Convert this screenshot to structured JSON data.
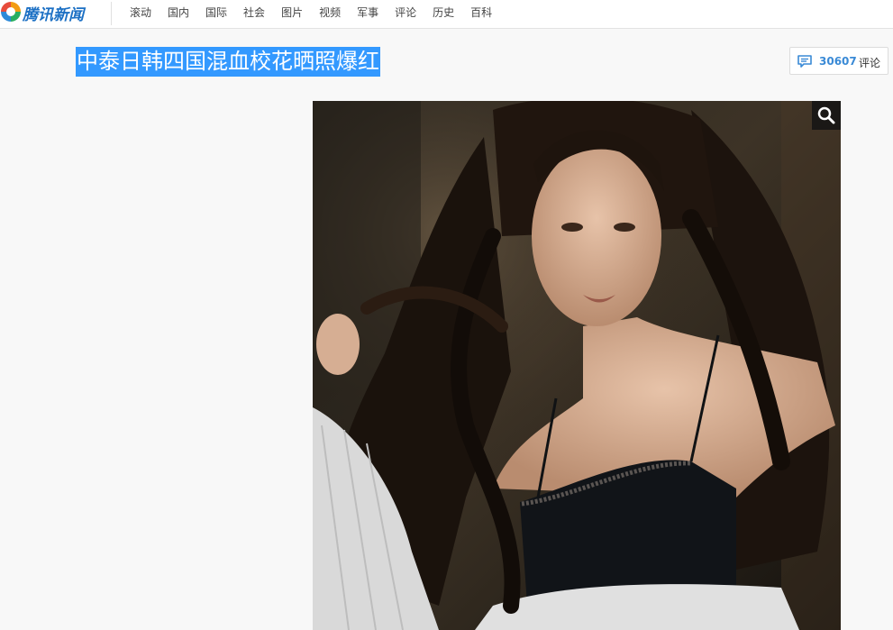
{
  "header": {
    "logo_text": "腾讯新闻",
    "nav": [
      "滚动",
      "国内",
      "国际",
      "社会",
      "图片",
      "视频",
      "军事",
      "评论",
      "历史",
      "百科"
    ]
  },
  "article": {
    "title": "中泰日韩四国混血校花晒照爆红"
  },
  "comments": {
    "count": "30607",
    "label": "评论"
  },
  "photo": {
    "zoom_icon": "magnifier-icon"
  },
  "colors": {
    "brand": "#1c70c4",
    "selection": "#3399ff",
    "comment_count": "#3a8ad6"
  }
}
